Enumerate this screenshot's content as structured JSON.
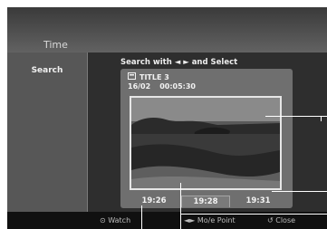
{
  "header": {
    "title": "Time"
  },
  "sidebar": {
    "label": "Search"
  },
  "instruction": "Search with ◄ ► and Select",
  "title_info": {
    "title": "TITLE 3",
    "date": "16/02",
    "time": "00:05:30",
    "icon": "disc-icon"
  },
  "timeline": {
    "times": [
      "19:26",
      "19:28",
      "19:31"
    ],
    "selected_index": 1
  },
  "footer": {
    "watch_label": "⊙ Watch",
    "move_label": "◄► Mo/e Point",
    "close_label": "↺ Close"
  },
  "colors": {
    "background": "#262626",
    "header": "#505050",
    "panel": "#6f6f6f",
    "footer": "#101010"
  }
}
